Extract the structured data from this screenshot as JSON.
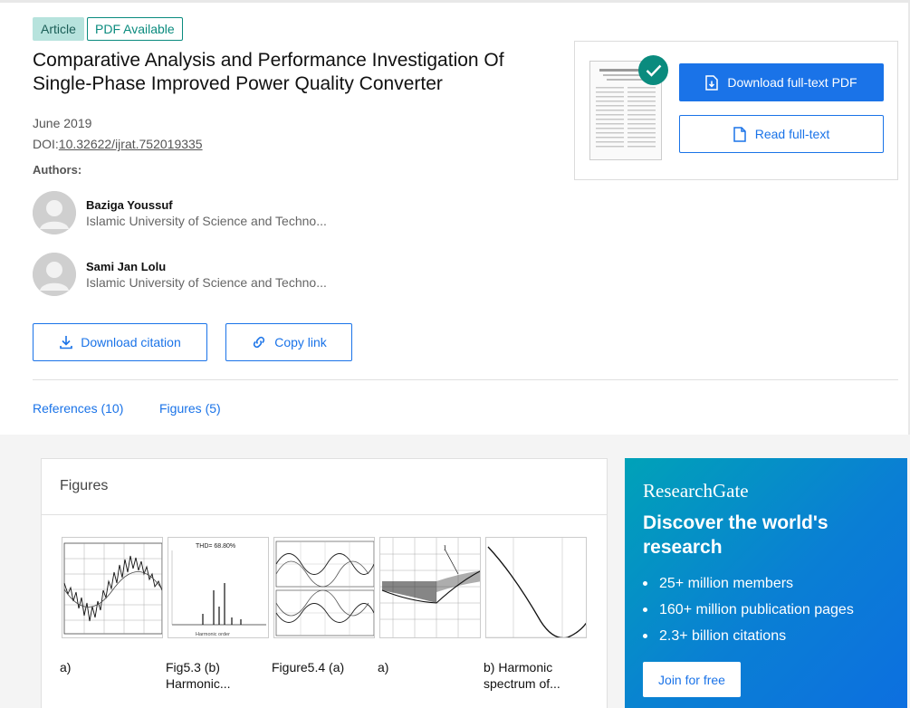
{
  "badges": {
    "article": "Article",
    "pdf": "PDF Available"
  },
  "title": "Comparative Analysis and Performance Investigation Of Single-Phase Improved Power Quality Converter",
  "date": "June 2019",
  "doi_label": "DOI:",
  "doi_value": "10.32622/ijrat.752019335",
  "authors_label": "Authors:",
  "authors": [
    {
      "name": "Baziga Youssuf",
      "affiliation": "Islamic University of Science and Techno..."
    },
    {
      "name": "Sami Jan Lolu",
      "affiliation": "Islamic University of Science and Techno..."
    }
  ],
  "actions": {
    "download_citation": "Download citation",
    "copy_link": "Copy link"
  },
  "tabs": {
    "references": "References (10)",
    "figures": "Figures (5)"
  },
  "pdf_card": {
    "download_pdf": "Download full-text PDF",
    "read_fulltext": "Read full-text"
  },
  "figures_panel": {
    "header": "Figures",
    "thd_label": "THD= 68.80%",
    "items": [
      {
        "caption": "a)"
      },
      {
        "caption": "Fig5.3 (b) Harmonic..."
      },
      {
        "caption": "Figure5.4 (a)"
      },
      {
        "caption": "a)"
      },
      {
        "caption": "b) Harmonic spectrum of..."
      }
    ]
  },
  "promo": {
    "logo": "ResearchGate",
    "heading": "Discover the world's research",
    "bullets": [
      "25+ million members",
      "160+ million publication pages",
      "2.3+ billion citations"
    ],
    "cta": "Join for free"
  },
  "colors": {
    "accent": "#1a73e8",
    "teal": "#0a8b7e",
    "promo_start": "#00a2b8",
    "promo_end": "#0d6fe0"
  }
}
